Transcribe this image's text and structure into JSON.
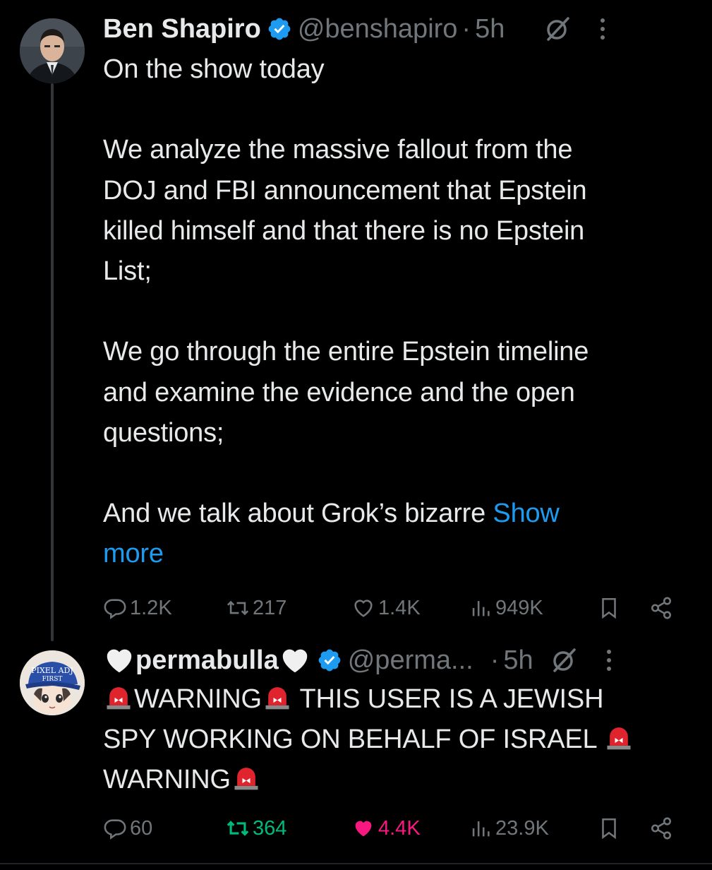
{
  "thread": {
    "parent": {
      "author_name": "Ben Shapiro",
      "handle": "@benshapiro",
      "separator": "·",
      "time": "5h",
      "body_lines": [
        "On the show today",
        "",
        "We analyze the massive fallout from the",
        "DOJ and FBI announcement that Epstein",
        "killed himself and that there is no Epstein",
        "List;",
        "",
        "We go through the entire Epstein timeline",
        "and examine the evidence and the open",
        "questions;",
        "",
        "And we talk about Grok’s bizarre "
      ],
      "show_more_line1": "Show",
      "show_more_line2": "more",
      "stats": {
        "replies": "1.2K",
        "reposts": "217",
        "likes": "1.4K",
        "views": "949K"
      }
    },
    "reply": {
      "author_name": "permabulla",
      "handle": "@perma...",
      "separator": "·",
      "time": "5h",
      "body_line1": "WARNING",
      "body_line1b": "  THIS USER IS A JEWISH",
      "body_line2": "SPY WORKING ON BEHALF OF ISRAEL ",
      "body_line3": "WARNING",
      "avatar_text_line1": "PIXEL ADJ",
      "avatar_text_line2": "FIRST",
      "stats": {
        "replies": "60",
        "reposts": "364",
        "likes": "4.4K",
        "views": "23.9K"
      }
    }
  },
  "colors": {
    "background": "#000000",
    "text": "#e7e9ea",
    "muted": "#71767b",
    "link": "#1d9bf0",
    "verified": "#1d9bf0",
    "retweet_active": "#00ba7c",
    "like_active": "#f91880"
  },
  "icons": [
    "verified-badge-icon",
    "grok-icon",
    "more-icon",
    "reply-icon",
    "repost-icon",
    "like-icon",
    "views-icon",
    "bookmark-icon",
    "share-icon",
    "siren-emoji",
    "white-heart-emoji"
  ]
}
